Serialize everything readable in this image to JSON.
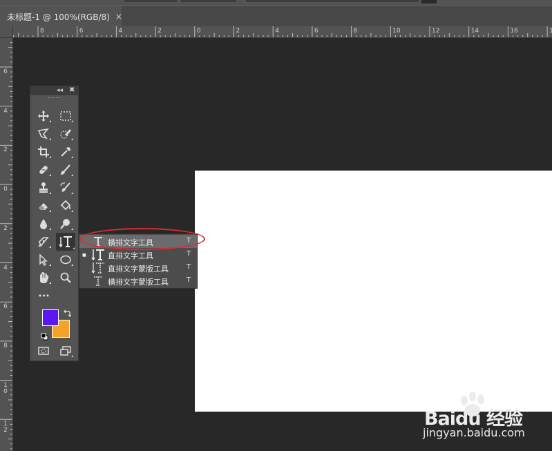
{
  "document_tab": {
    "title": "未标题-1 @ 100%(RGB/8)",
    "close_glyph": "×"
  },
  "rulers": {
    "horizontal_labels": [
      "8",
      "6",
      "4",
      "2",
      "0",
      "2",
      "4",
      "6",
      "8",
      "10",
      "12",
      "14",
      "16",
      "18"
    ],
    "vertical_labels": [
      "6",
      "4",
      "2",
      "0",
      "2",
      "4",
      "6",
      "8",
      "10",
      "12"
    ]
  },
  "toolbox": {
    "collapse_glyph": "◂◂",
    "close_glyph": "✖",
    "tools": [
      {
        "icon": "move-icon"
      },
      {
        "icon": "marquee-icon"
      },
      {
        "icon": "lasso-icon"
      },
      {
        "icon": "quick-selection-icon"
      },
      {
        "icon": "crop-icon"
      },
      {
        "icon": "eyedropper-icon"
      },
      {
        "icon": "healing-brush-icon"
      },
      {
        "icon": "brush-icon"
      },
      {
        "icon": "clone-stamp-icon"
      },
      {
        "icon": "history-brush-icon"
      },
      {
        "icon": "eraser-icon"
      },
      {
        "icon": "paint-bucket-icon"
      },
      {
        "icon": "blur-icon"
      },
      {
        "icon": "dodge-icon"
      },
      {
        "icon": "pen-icon"
      },
      {
        "icon": "vertical-type-icon"
      },
      {
        "icon": "path-selection-icon"
      },
      {
        "icon": "ellipse-icon"
      },
      {
        "icon": "hand-icon"
      },
      {
        "icon": "zoom-icon"
      }
    ],
    "more_glyph": "•••",
    "foreground_color": "#5b16f5",
    "background_color": "#f3a327"
  },
  "type_flyout": {
    "items": [
      {
        "label": "横排文字工具",
        "shortcut": "T",
        "icon": "horizontal-type-icon",
        "selected": false
      },
      {
        "label": "直排文字工具",
        "shortcut": "T",
        "icon": "vertical-type-icon",
        "selected": true
      },
      {
        "label": "直排文字蒙版工具",
        "shortcut": "T",
        "icon": "vertical-type-mask-icon",
        "selected": false
      },
      {
        "label": "横排文字蒙版工具",
        "shortcut": "T",
        "icon": "horizontal-type-mask-icon",
        "selected": false
      }
    ],
    "selected_marker": "■"
  },
  "annotation": {
    "color": "#d82d2d"
  },
  "watermark": {
    "logo_text": "Baidu 经验",
    "url": "jingyan.baidu.com"
  }
}
